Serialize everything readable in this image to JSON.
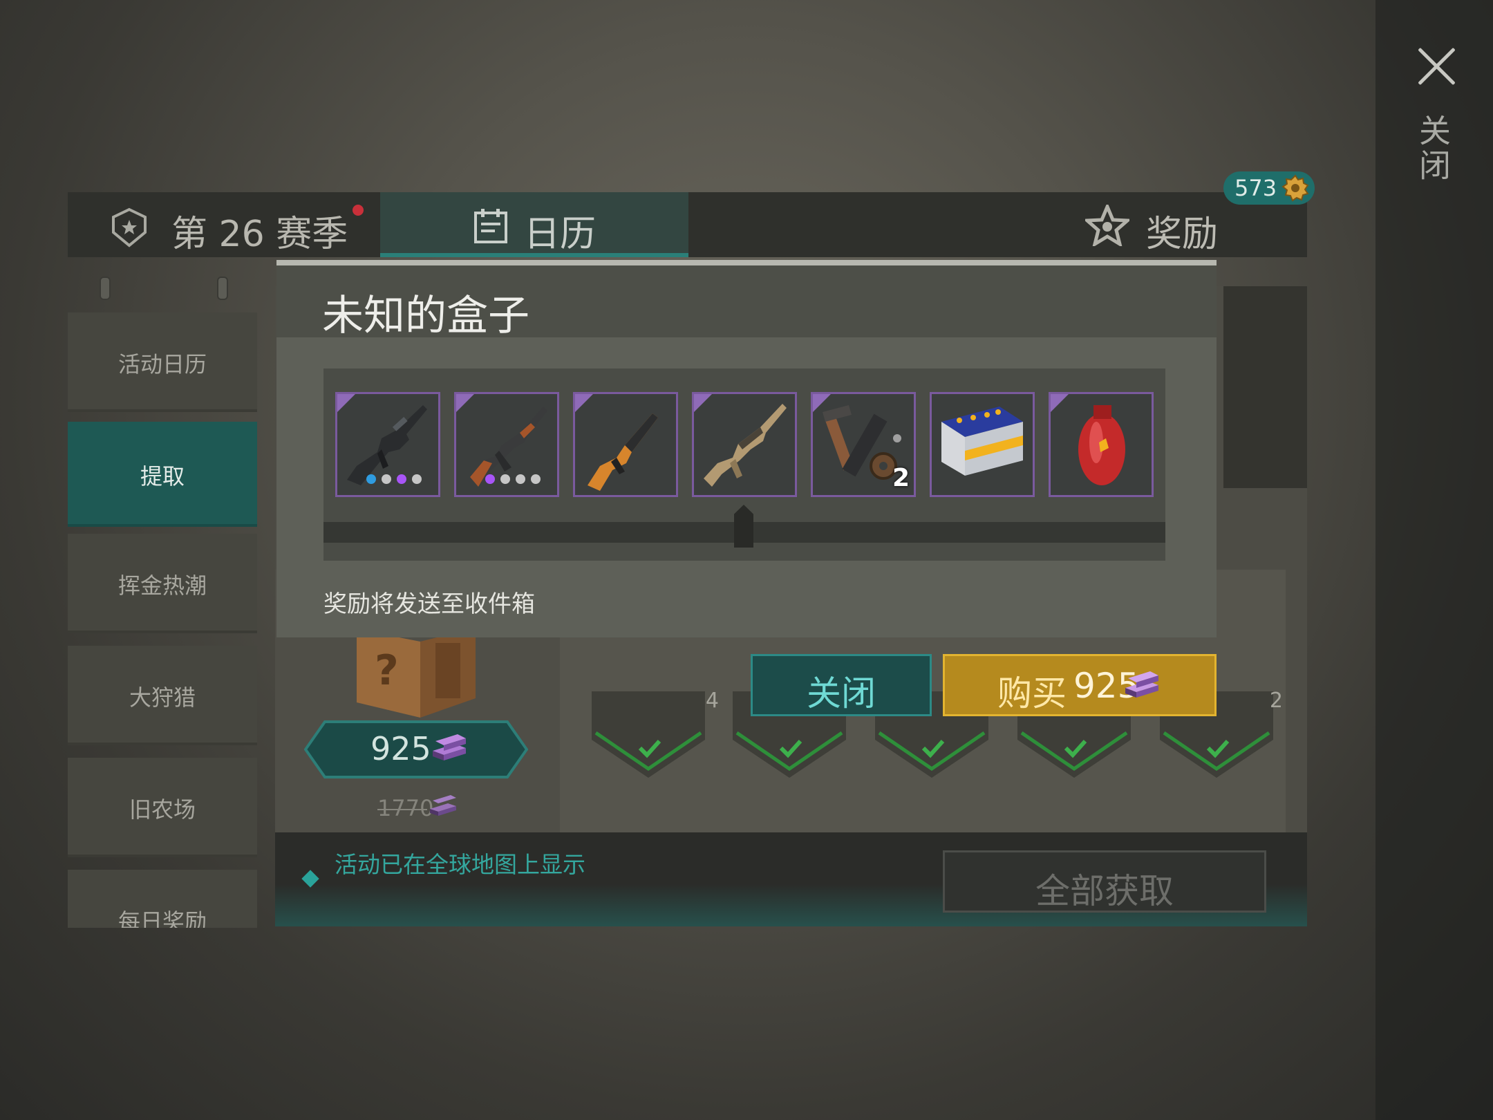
{
  "header": {
    "season_label": "第 26 赛季",
    "calendar_label": "日历",
    "rewards_label": "奖励",
    "badge_count": "573"
  },
  "close_label": "关闭",
  "sidebar": {
    "items": [
      {
        "label": "活动日历"
      },
      {
        "label": "提取"
      },
      {
        "label": "挥金热潮"
      },
      {
        "label": "大狩猎"
      },
      {
        "label": "旧农场"
      },
      {
        "label": "每日奖励"
      }
    ],
    "active_index": 1
  },
  "offer": {
    "price": "925",
    "old_price": "1770"
  },
  "reward_counts": [
    "4",
    "2"
  ],
  "notice": "活动已在全球地图上显示",
  "get_all_label": "全部获取",
  "modal": {
    "title": "未知的盒子",
    "items": [
      {
        "icon": "m16-rifle-icon",
        "dots": [
          "#2f9ce0",
          "#c6c6c6",
          "#a855f7",
          "#c6c6c6"
        ]
      },
      {
        "icon": "ak-rifle-icon",
        "dots": [
          "#a855f7",
          "#c6c6c6",
          "#c6c6c6",
          "#c6c6c6"
        ]
      },
      {
        "icon": "orange-rifle-icon"
      },
      {
        "icon": "tan-assault-rifle-icon"
      },
      {
        "icon": "tool-parts-icon",
        "quantity": "2"
      },
      {
        "icon": "battery-icon"
      },
      {
        "icon": "gas-cylinder-icon"
      }
    ],
    "note": "奖励将发送至收件箱",
    "close_button": "关闭",
    "buy_label": "购买",
    "buy_price": "925"
  },
  "colors": {
    "accent_teal": "#1e5954",
    "buy_gold": "#b58a1e",
    "rarity_purple": "#8f6bb8"
  }
}
